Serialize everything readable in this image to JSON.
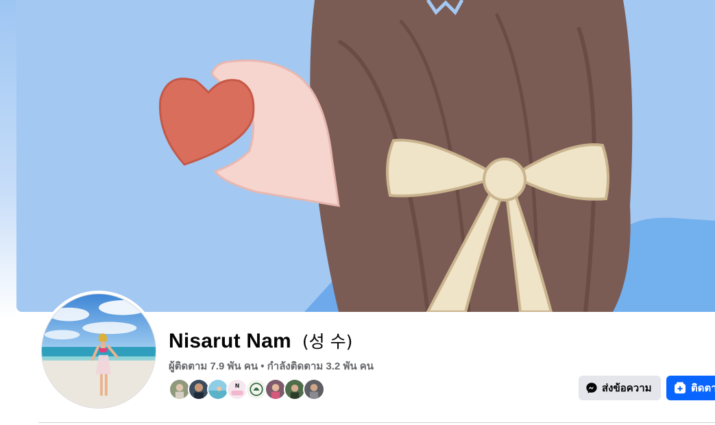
{
  "profile": {
    "name": "Nisarut Nam",
    "alternate_name": "(성 수)",
    "followers_label": "ผู้ติดตาม 7.9 พัน คน",
    "separator": " • ",
    "following_label": "กำลังติดตาม 3.2 พัน คน"
  },
  "cover_photo": {
    "icon": "cover-illustration"
  },
  "profile_picture": {
    "icon": "beach-photo"
  },
  "mutual_friends": {
    "count": 8,
    "icons": [
      "friend-avatar",
      "friend-avatar",
      "friend-avatar",
      "page-logo",
      "page-logo",
      "friend-avatar",
      "friend-avatar",
      "friend-avatar"
    ]
  },
  "actions": {
    "message_label": "ส่งข้อความ",
    "follow_label": "ติดตาม"
  },
  "colors": {
    "primary": "#0866ff",
    "secondary_button": "#e4e6eb",
    "text_primary": "#050505",
    "text_secondary": "#65676b",
    "cover_sky": "#a3c8f2"
  }
}
